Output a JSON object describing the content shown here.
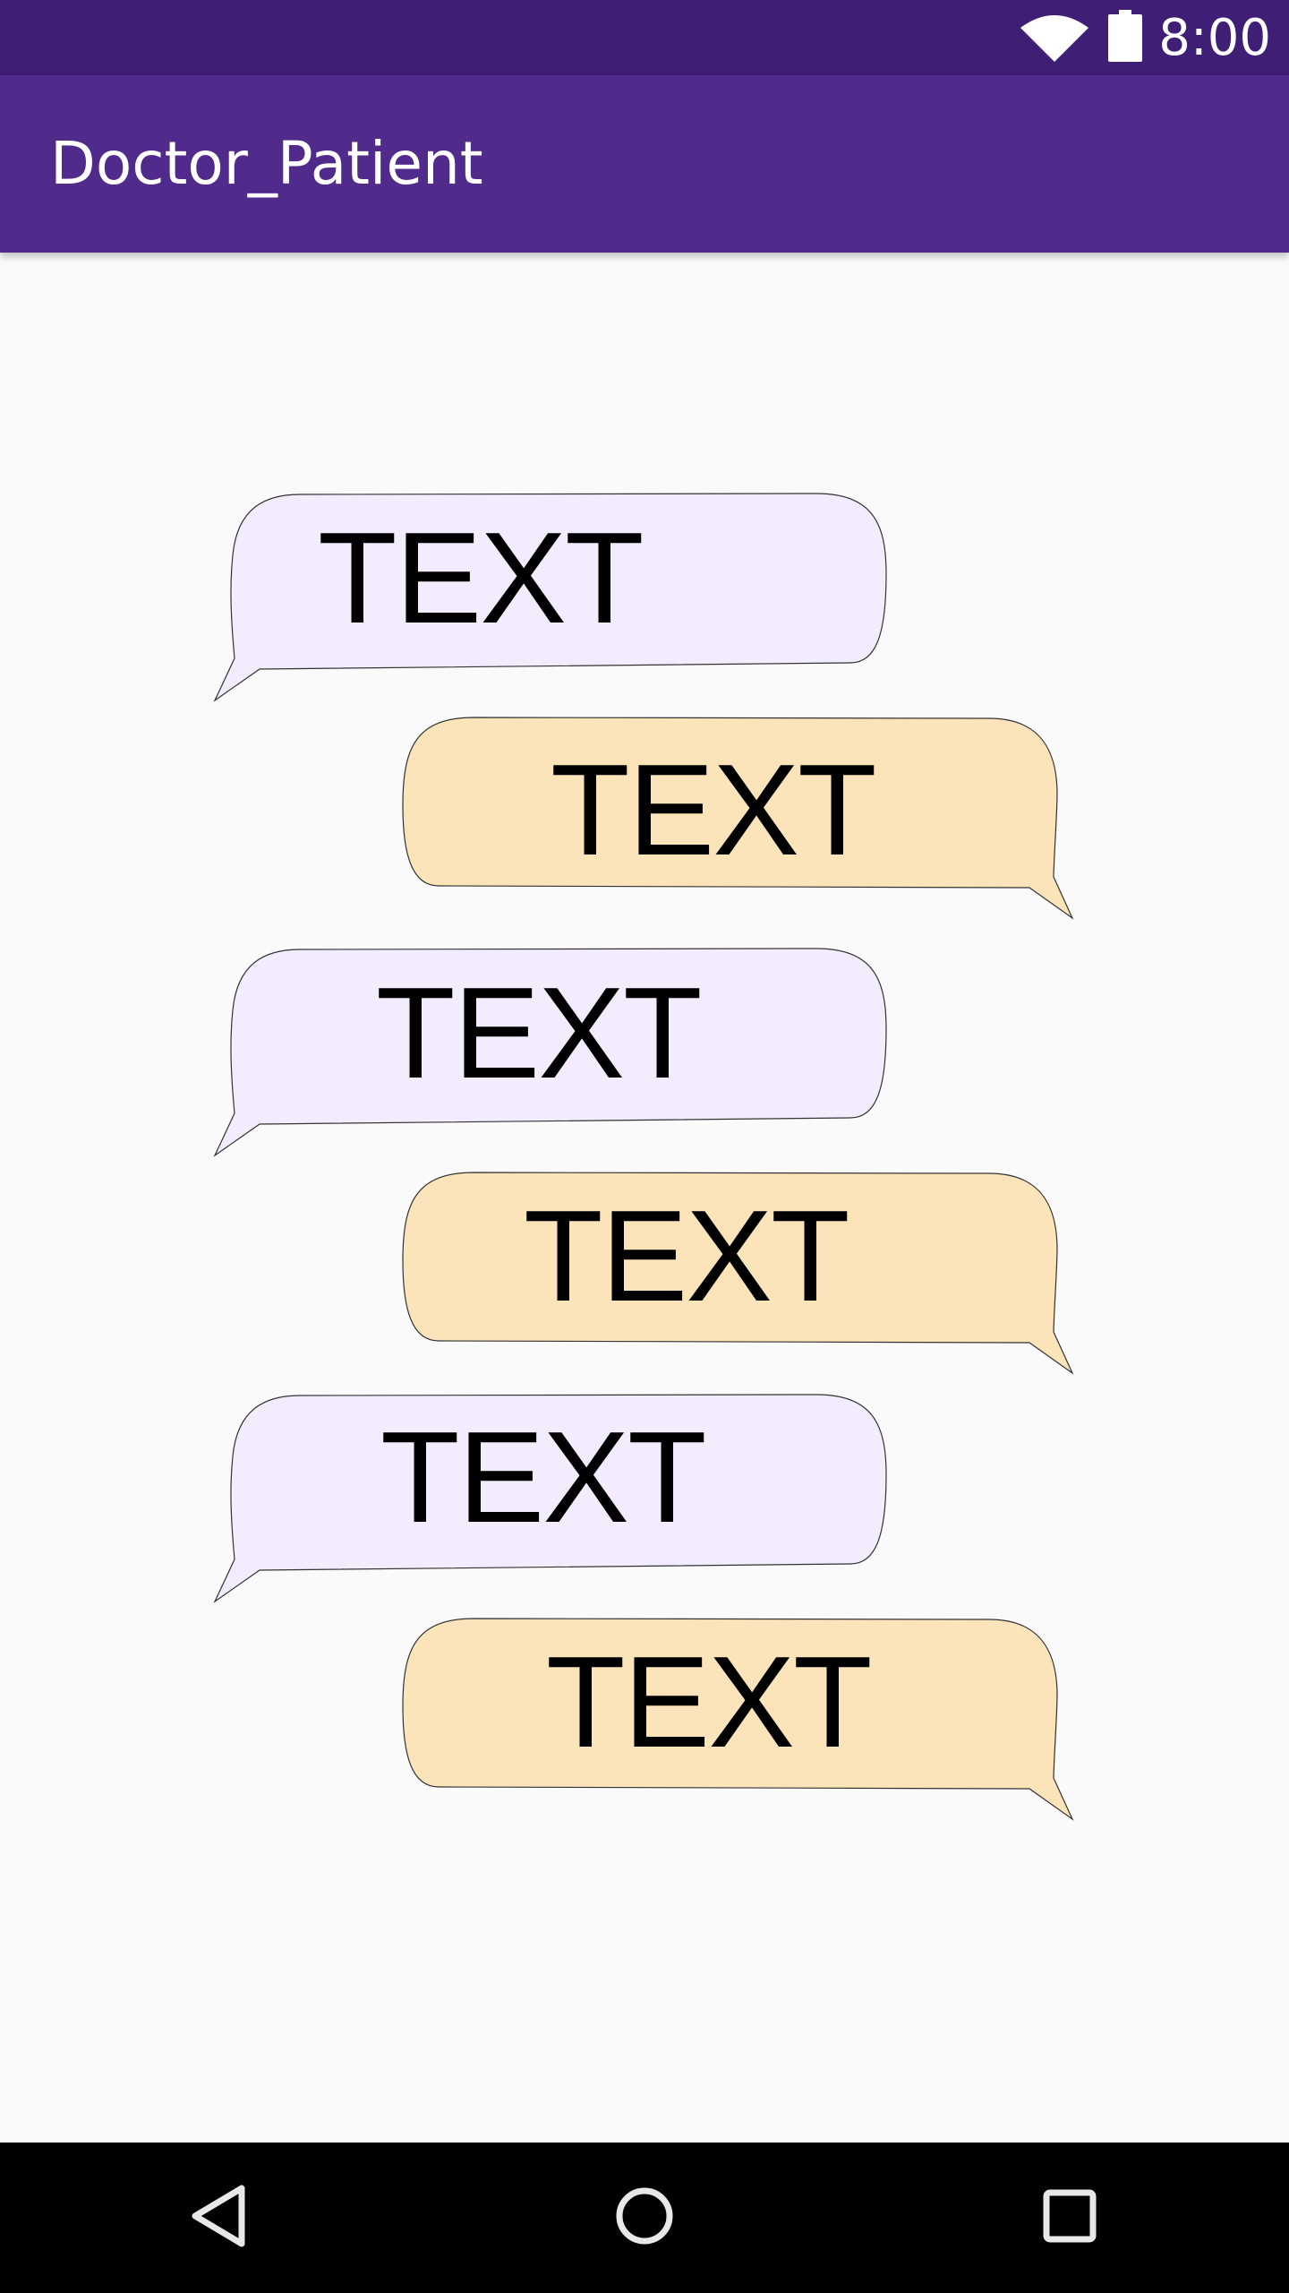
{
  "status_bar": {
    "time": "8:00",
    "icons": [
      "wifi-icon",
      "battery-icon"
    ]
  },
  "app_bar": {
    "title": "Doctor_Patient"
  },
  "colors": {
    "status_bar": "#3f1f75",
    "app_bar": "#502b8c",
    "incoming_bubble": "#f2ecfe",
    "outgoing_bubble": "#fbe3ba",
    "background": "#fafafa"
  },
  "messages": [
    {
      "sender": "incoming",
      "text": "TEXT"
    },
    {
      "sender": "outgoing",
      "text": "TEXT"
    },
    {
      "sender": "incoming",
      "text": "TEXT"
    },
    {
      "sender": "outgoing",
      "text": "TEXT"
    },
    {
      "sender": "incoming",
      "text": "TEXT"
    },
    {
      "sender": "outgoing",
      "text": "TEXT"
    }
  ],
  "nav_bar": {
    "buttons": [
      "back-icon",
      "home-icon",
      "recents-icon"
    ]
  }
}
